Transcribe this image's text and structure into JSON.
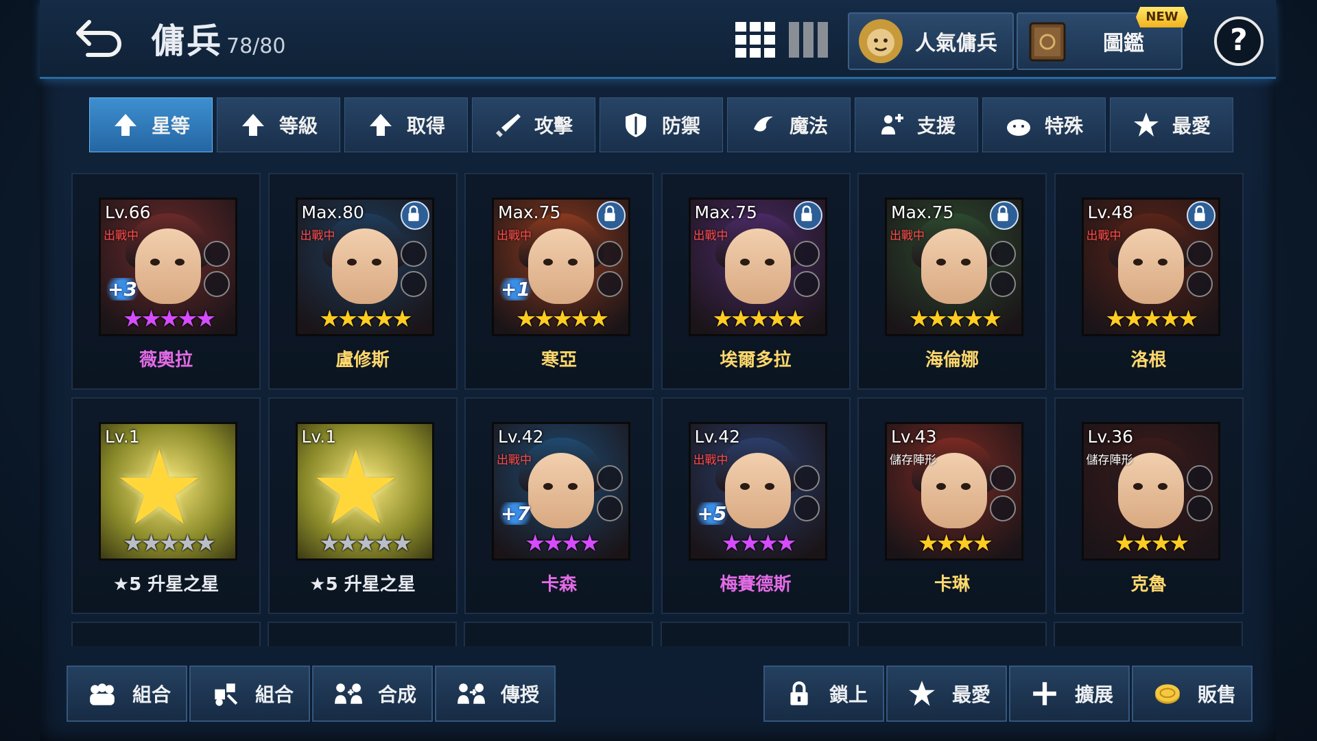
{
  "header": {
    "title": "傭兵",
    "count": "78/80",
    "popular_label": "人氣傭兵",
    "codex_label": "圖鑑",
    "new_badge": "NEW",
    "help": "?"
  },
  "sort_tabs": [
    {
      "label": "星等",
      "icon": "arrow-up-icon",
      "active": true
    },
    {
      "label": "等級",
      "icon": "arrow-up-icon",
      "active": false
    },
    {
      "label": "取得",
      "icon": "arrow-up-icon",
      "active": false
    },
    {
      "label": "攻擊",
      "icon": "sword-icon",
      "active": false
    },
    {
      "label": "防禦",
      "icon": "shield-icon",
      "active": false
    },
    {
      "label": "魔法",
      "icon": "magic-icon",
      "active": false
    },
    {
      "label": "支援",
      "icon": "support-icon",
      "active": false
    },
    {
      "label": "特殊",
      "icon": "special-icon",
      "active": false
    },
    {
      "label": "最愛",
      "icon": "star-icon",
      "active": false
    }
  ],
  "cards": [
    {
      "level": "Lv.66",
      "status": "出戰中",
      "plus": "+3",
      "stars": "★★★★★",
      "star_color": "purple",
      "name": "薇奧拉",
      "name_color": "purple",
      "locked": false,
      "color": "#6b2a2a"
    },
    {
      "level": "Max.80",
      "status": "出戰中",
      "plus": "",
      "stars": "★★★★★",
      "star_color": "gold",
      "name": "盧修斯",
      "name_color": "gold",
      "locked": true,
      "color": "#1d3c5a"
    },
    {
      "level": "Max.75",
      "status": "出戰中",
      "plus": "+1",
      "stars": "★★★★★",
      "star_color": "gold",
      "name": "寒亞",
      "name_color": "gold",
      "locked": true,
      "color": "#8a3a1e"
    },
    {
      "level": "Max.75",
      "status": "出戰中",
      "plus": "",
      "stars": "★★★★★",
      "star_color": "gold",
      "name": "埃爾多拉",
      "name_color": "gold",
      "locked": true,
      "color": "#4a2a66"
    },
    {
      "level": "Max.75",
      "status": "出戰中",
      "plus": "",
      "stars": "★★★★★",
      "star_color": "gold",
      "name": "海倫娜",
      "name_color": "gold",
      "locked": true,
      "color": "#2c4a2e"
    },
    {
      "level": "Lv.48",
      "status": "出戰中",
      "plus": "",
      "stars": "★★★★★",
      "star_color": "gold",
      "name": "洛根",
      "name_color": "gold",
      "locked": true,
      "color": "#5a2418"
    },
    {
      "level": "Lv.1",
      "status": "",
      "plus": "",
      "stars": "★★★★★",
      "star_color": "silver",
      "name": "★5 升星之星",
      "name_color": "white",
      "locked": false,
      "color": "#6d6a1a"
    },
    {
      "level": "Lv.1",
      "status": "",
      "plus": "",
      "stars": "★★★★★",
      "star_color": "silver",
      "name": "★5 升星之星",
      "name_color": "white",
      "locked": false,
      "color": "#6d6a1a"
    },
    {
      "level": "Lv.42",
      "status": "出戰中",
      "plus": "+7",
      "stars": "★★★★",
      "star_color": "purple",
      "name": "卡森",
      "name_color": "purple",
      "locked": false,
      "color": "#1f4a70"
    },
    {
      "level": "Lv.42",
      "status": "出戰中",
      "plus": "+5",
      "stars": "★★★★",
      "star_color": "purple",
      "name": "梅賽德斯",
      "name_color": "purple",
      "locked": false,
      "color": "#2a3e6a"
    },
    {
      "level": "Lv.43",
      "status": "儲存陣形",
      "plus": "",
      "stars": "★★★★",
      "star_color": "gold",
      "name": "卡琳",
      "name_color": "gold",
      "locked": false,
      "color": "#7a2a22"
    },
    {
      "level": "Lv.36",
      "status": "儲存陣形",
      "plus": "",
      "stars": "★★★★",
      "star_color": "gold",
      "name": "克魯",
      "name_color": "gold",
      "locked": false,
      "color": "#3a1a1a"
    }
  ],
  "bottom_left": [
    {
      "label": "組合",
      "icon": "group-icon"
    },
    {
      "label": "組合",
      "icon": "puzzle-icon"
    },
    {
      "label": "合成",
      "icon": "merge-icon"
    },
    {
      "label": "傳授",
      "icon": "transfer-icon"
    }
  ],
  "bottom_right": [
    {
      "label": "鎖上",
      "icon": "lock-icon"
    },
    {
      "label": "最愛",
      "icon": "star-icon"
    },
    {
      "label": "擴展",
      "icon": "plus-icon"
    },
    {
      "label": "販售",
      "icon": "coin-icon"
    }
  ]
}
